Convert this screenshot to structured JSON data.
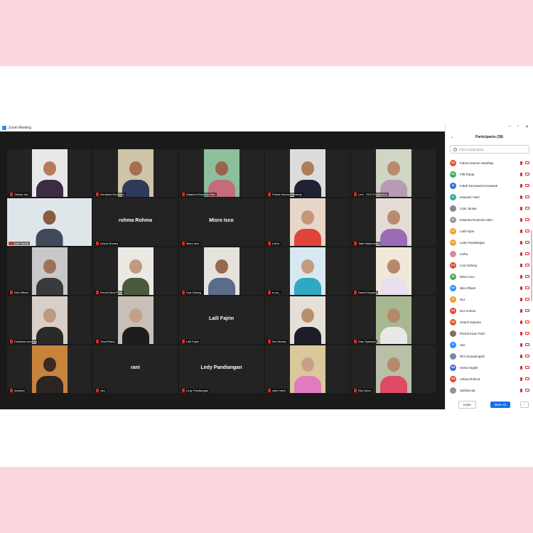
{
  "window": {
    "title": "Zoom Meeting"
  },
  "tiles": [
    {
      "name": "Sahida Ida",
      "video": true,
      "bg": "#e8e8e8",
      "skin": "#b47a5a",
      "cloth": "#3b2c44"
    },
    {
      "name": "Nurdiana Nurdiana",
      "video": true,
      "bg": "#cfc3a8",
      "skin": "#a86e52",
      "cloth": "#2e3a5c"
    },
    {
      "name": "Katarina Rosmina Sibo",
      "video": true,
      "bg": "#8dbf9c",
      "skin": "#9b6448",
      "cloth": "#c46b7c"
    },
    {
      "name": "Fatma Hanum Harahap",
      "video": true,
      "bg": "#dcdcdc",
      "skin": "#b07c5c",
      "cloth": "#1e2233"
    },
    {
      "name": "Leni - SCO Foundation",
      "video": true,
      "bg": "#cfd6c4",
      "skin": "#bb8a6c",
      "cloth": "#b89ab5"
    },
    {
      "name": "Dion Taufik",
      "video": true,
      "bg": "#dfe6ea",
      "skin": "#8a5b40",
      "cloth": "#3e4a5a",
      "active": true
    },
    {
      "name": "rohma Rohma",
      "video": false,
      "bigname": "rohma Rohma"
    },
    {
      "name": "Misro Isco",
      "video": false,
      "bigname": "Misro Isco"
    },
    {
      "name": "Leiha",
      "video": true,
      "bg": "#e8d6c8",
      "skin": "#c69478",
      "cloth": "#e0453c"
    },
    {
      "name": "Tatik Mahmudah",
      "video": true,
      "bg": "#e2dcd4",
      "skin": "#b98a70",
      "cloth": "#9b6bb8"
    },
    {
      "name": "Nila Oftiarti",
      "video": true,
      "bg": "#c8c8c8",
      "skin": "#9e7258",
      "cloth": "#3a3a3a"
    },
    {
      "name": "Prezdi Kiran Putri",
      "video": true,
      "bg": "#ece8e4",
      "skin": "#c29a80",
      "cloth": "#4a5a3c"
    },
    {
      "name": "Lisa Galung",
      "video": true,
      "bg": "#e6e2dc",
      "skin": "#98694e",
      "cloth": "#5b6b8a"
    },
    {
      "name": "uLan_",
      "video": true,
      "bg": "#d8e8f0",
      "skin": "#c49c82",
      "cloth": "#2fa8c4"
    },
    {
      "name": "Osami Dayana",
      "video": true,
      "bg": "#f0e8d8",
      "skin": "#b8886c",
      "cloth": "#e8e0f0"
    },
    {
      "name": "Fathimah Azzahra",
      "video": true,
      "bg": "#d8d0c8",
      "skin": "#c09a80",
      "cloth": "#2a2a2a"
    },
    {
      "name": "Yana Riana",
      "video": true,
      "bg": "#c8c0b8",
      "skin": "#c4a08a",
      "cloth": "#1c1c1c"
    },
    {
      "name": "Laili Fajrin",
      "video": false,
      "bigname": "Laili Fajrin"
    },
    {
      "name": "Nur Annisa",
      "video": true,
      "bg": "#e4e0d8",
      "skin": "#b8906e",
      "cloth": "#1e1e2a"
    },
    {
      "name": "Dian Syafwari",
      "video": true,
      "bg": "#a8b890",
      "skin": "#b48a6c",
      "cloth": "#e8e8e8"
    },
    {
      "name": "sindyani",
      "video": true,
      "bg": "#c8843c",
      "skin": "#3a2a22",
      "cloth": "#2a2422"
    },
    {
      "name": "rani",
      "video": false,
      "bigname": "rani"
    },
    {
      "name": "Ledy Pandiangan",
      "video": false,
      "bigname": "Ledy Pandiangan"
    },
    {
      "name": "saini merix",
      "video": true,
      "bg": "#d8c89a",
      "skin": "#c8a088",
      "cloth": "#e27ac0"
    },
    {
      "name": "Elly Zahro",
      "video": true,
      "bg": "#b8c0a8",
      "skin": "#b8886c",
      "cloth": "#e04a64"
    }
  ],
  "panel": {
    "title": "Participants (38)",
    "search_placeholder": "Find a participant",
    "participants": [
      {
        "initials": "FH",
        "name": "Fatma Hanum Harahap",
        "color": "#e0582f"
      },
      {
        "initials": "FR",
        "name": "Fifit Rinda",
        "color": "#3fae5a"
      },
      {
        "initials": "IK",
        "name": "Indah kurnawati Kurnawati",
        "color": "#3b6fd6"
      },
      {
        "initials": "IY",
        "name": "Irwiyanti Yanti",
        "color": "#2fb0a4"
      },
      {
        "initials": "",
        "name": "Julie Juntas",
        "color": "#888888"
      },
      {
        "initials": "K",
        "name": "Katarina Rosmina Sibo",
        "color": "#9a9a9a"
      },
      {
        "initials": "LF",
        "name": "Laili Fajrin",
        "color": "#f0a030"
      },
      {
        "initials": "LP",
        "name": "Ledy Pandiangan",
        "color": "#f0a030"
      },
      {
        "initials": "",
        "name": "Leiha",
        "color": "#d88a9a"
      },
      {
        "initials": "LG",
        "name": "Lisa Galung",
        "color": "#e04a3c"
      },
      {
        "initials": "MI",
        "name": "Misro Isco",
        "color": "#3fae5a"
      },
      {
        "initials": "NO",
        "name": "Nila Oftiarti",
        "color": "#2d8cff"
      },
      {
        "initials": "N",
        "name": "Nur",
        "color": "#f0a030"
      },
      {
        "initials": "NA",
        "name": "Nur Annisa",
        "color": "#e04a3c"
      },
      {
        "initials": "OD",
        "name": "Osami Dayana",
        "color": "#e0582f"
      },
      {
        "initials": "",
        "name": "Prezdi Kiran Putri",
        "color": "#8a6a5a"
      },
      {
        "initials": "R",
        "name": "rani",
        "color": "#2d8cff"
      },
      {
        "initials": "",
        "name": "Rini Suryaningsih",
        "color": "#7a8aa0"
      },
      {
        "initials": "RN",
        "name": "risma nngsih",
        "color": "#3b6fd6"
      },
      {
        "initials": "RR",
        "name": "rohma Rohma",
        "color": "#e04a3c"
      },
      {
        "initials": "",
        "name": "Sahida Ida",
        "color": "#a0908a"
      }
    ],
    "invite_label": "Invite",
    "mute_all_label": "Mute All",
    "more_label": "···"
  }
}
